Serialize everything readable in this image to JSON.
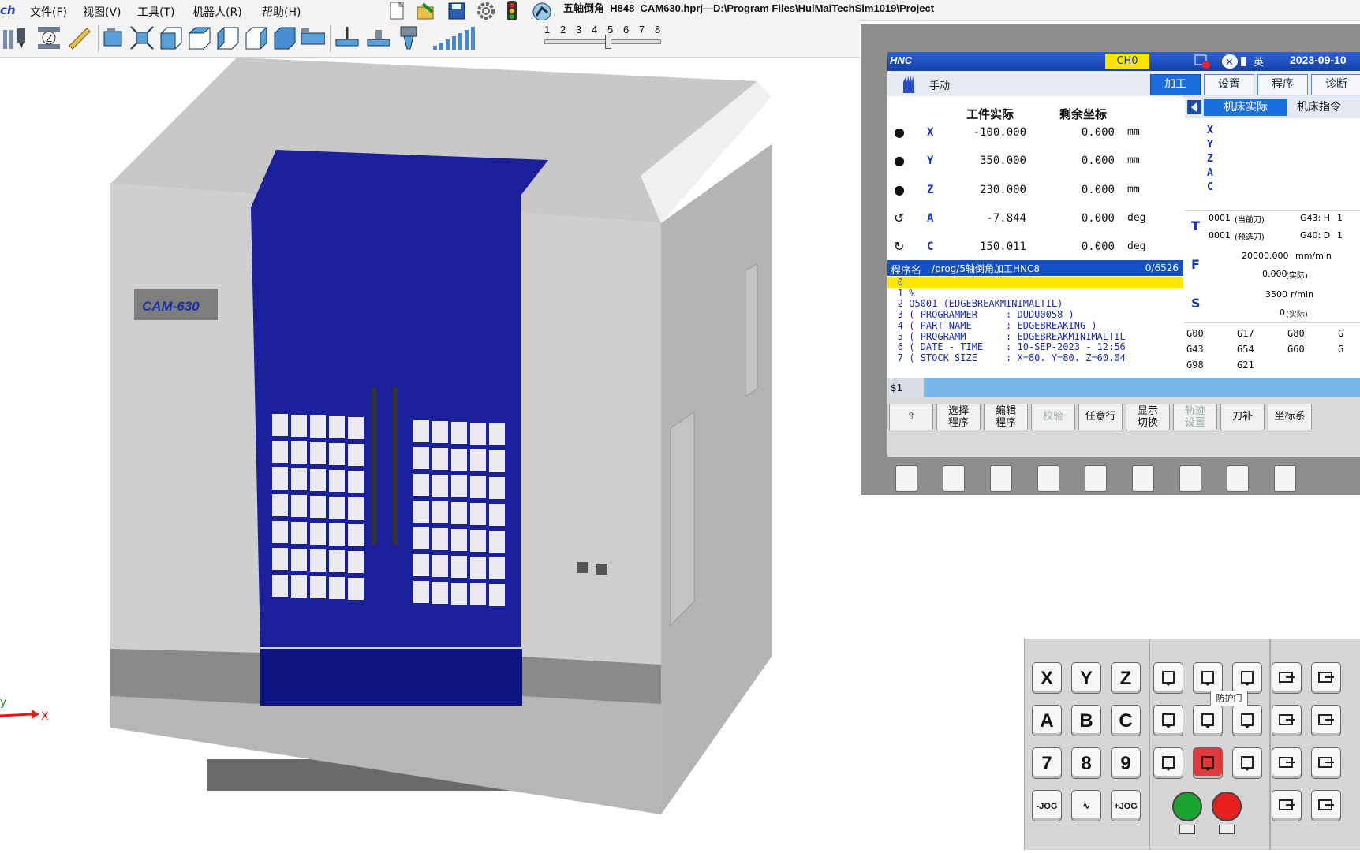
{
  "app": {
    "brand": "ch",
    "title": "五轴倒角_H848_CAM630.hprj—D:\\Program Files\\HuiMaiTechSim1019\\Project",
    "menu": [
      "文件(F)",
      "视图(V)",
      "工具(T)",
      "机器人(R)",
      "帮助(H)"
    ],
    "speed_scale": [
      "1",
      "2",
      "3",
      "4",
      "5",
      "6",
      "7",
      "8"
    ],
    "speed_value": 0.55
  },
  "viewport": {
    "machine_label": "CAM-630",
    "axis_x": "X",
    "axis_y": "y",
    "door_color": "#1a1f9a"
  },
  "cnc": {
    "logo": "HNC",
    "channel": "CH0",
    "lang": "英",
    "date": "2023-09-10",
    "mode": "手动",
    "tabs": [
      "加工",
      "设置",
      "程序",
      "诊断"
    ],
    "active_tab": "加工",
    "col_headers": [
      "工件实际",
      "剩余坐标"
    ],
    "axes": [
      {
        "name": "X",
        "actual": "-100.000",
        "remain": "0.000",
        "unit": "mm"
      },
      {
        "name": "Y",
        "actual": "350.000",
        "remain": "0.000",
        "unit": "mm"
      },
      {
        "name": "Z",
        "actual": "230.000",
        "remain": "0.000",
        "unit": "mm"
      },
      {
        "name": "A",
        "actual": "-7.844",
        "remain": "0.000",
        "unit": "deg"
      },
      {
        "name": "C",
        "actual": "150.011",
        "remain": "0.000",
        "unit": "deg"
      }
    ],
    "program": {
      "label": "程序名",
      "path": "/prog/5轴倒角加工HNC8",
      "count": "0/6526",
      "lines": [
        {
          "no": "0",
          "text": ""
        },
        {
          "no": "1",
          "text": "%"
        },
        {
          "no": "2",
          "text": "O5001 (EDGEBREAKMINIMALTIL)"
        },
        {
          "no": "3",
          "text": "( PROGRAMMER     : DUDU0058 )"
        },
        {
          "no": "4",
          "text": "( PART NAME      : EDGEBREAKING )"
        },
        {
          "no": "5",
          "text": "( PROGRAMM       : EDGEBREAKMINIMALTIL"
        },
        {
          "no": "6",
          "text": "( DATE - TIME    : 10-SEP-2023 - 12:56"
        },
        {
          "no": "7",
          "text": "( STOCK SIZE     : X=80. Y=80. Z=60.04"
        }
      ]
    },
    "cmd_prompt": "$1",
    "softkeys": [
      {
        "label": "⇧",
        "disabled": false
      },
      {
        "label": "选择\n程序",
        "disabled": false
      },
      {
        "label": "编辑\n程序",
        "disabled": false
      },
      {
        "label": "校验",
        "disabled": true
      },
      {
        "label": "任意行",
        "disabled": false
      },
      {
        "label": "显示\n切换",
        "disabled": false
      },
      {
        "label": "轨迹\n设置",
        "disabled": true
      },
      {
        "label": "刀补",
        "disabled": false
      },
      {
        "label": "坐标系",
        "disabled": false
      }
    ],
    "right": {
      "tabs": [
        "机床实际",
        "机床指令"
      ],
      "axis_letters": [
        "X",
        "Y",
        "Z",
        "A",
        "C"
      ],
      "tool": {
        "label": "T",
        "current": "0001",
        "current_note": "(当前刀)",
        "next": "0001",
        "next_note": "(预选刀)",
        "g43": "G43: H",
        "g40": "G40: D",
        "g43_v": "1",
        "g40_v": "1"
      },
      "feed": {
        "label": "F",
        "value": "20000.000",
        "unit": "mm/min",
        "actual": "0.000",
        "actual_note": "(实际)"
      },
      "spindle": {
        "label": "S",
        "value": "3500",
        "unit": "r/min",
        "actual": "0",
        "actual_note": "(实际)"
      },
      "gcodes": [
        "G00",
        "G17",
        "G80",
        "G",
        "G43",
        "G54",
        "G60",
        "G",
        "G98",
        "G21",
        "",
        ""
      ]
    }
  },
  "operator_panel": {
    "axis_keys": [
      "X",
      "Y",
      "Z",
      "A",
      "B",
      "C",
      "7",
      "8",
      "9"
    ],
    "jog_keys": [
      "-JOG",
      "∿",
      "+JOG"
    ],
    "tooltip": "防护门",
    "start_color": "#1aa32e",
    "stop_color": "#e51e1e"
  }
}
